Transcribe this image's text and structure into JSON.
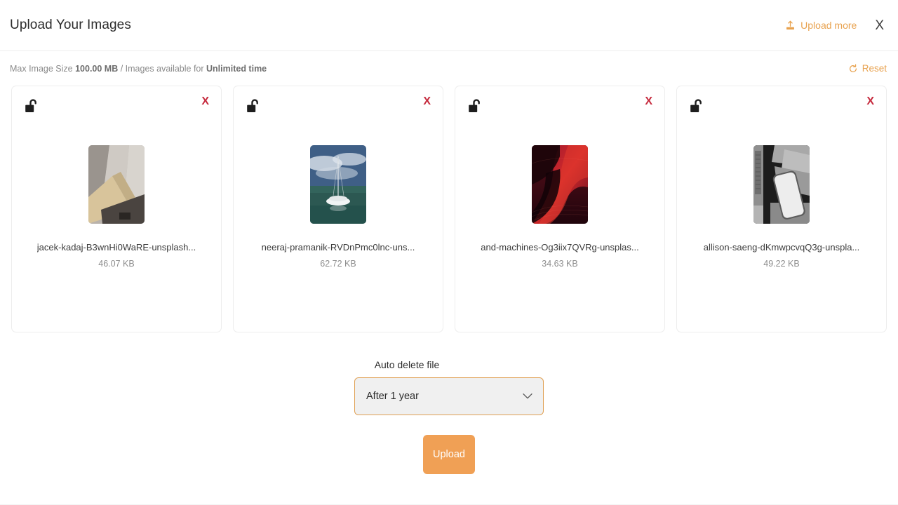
{
  "header": {
    "title": "Upload Your Images",
    "upload_more_label": "Upload more",
    "upload_more_icon": "upload-icon",
    "close_icon": "close-icon",
    "close_label": "X",
    "accent_color": "#e8a24f"
  },
  "infobar": {
    "prefix": "Max Image Size ",
    "max_size": "100.00 MB",
    "middle": " / Images available for ",
    "availability": "Unlimited time",
    "reset_label": "Reset",
    "reset_icon": "refresh-icon"
  },
  "cards": [
    {
      "lock_icon": "unlock-icon",
      "remove_label": "X",
      "filename": "jacek-kadaj-B3wnHi0WaRE-unsplash...",
      "size": "46.07 KB",
      "thumb_name": "thumbnail-concrete-surfaces"
    },
    {
      "lock_icon": "unlock-icon",
      "remove_label": "X",
      "filename": "neeraj-pramanik-RVDnPmc0lnc-uns...",
      "size": "62.72 KB",
      "thumb_name": "thumbnail-sailboat-ocean"
    },
    {
      "lock_icon": "unlock-icon",
      "remove_label": "X",
      "filename": "and-machines-Og3iix7QVRg-unsplas...",
      "size": "34.63 KB",
      "thumb_name": "thumbnail-red-abstract-wave"
    },
    {
      "lock_icon": "unlock-icon",
      "remove_label": "X",
      "filename": "allison-saeng-dKmwpcvqQ3g-unspla...",
      "size": "49.22 KB",
      "thumb_name": "thumbnail-phone-greyscale"
    }
  ],
  "footer": {
    "autodelete_label": "Auto delete file",
    "autodelete_value": "After 1 year",
    "chevron_icon": "chevron-down-icon",
    "upload_label": "Upload",
    "upload_button_color": "#f0a055"
  }
}
